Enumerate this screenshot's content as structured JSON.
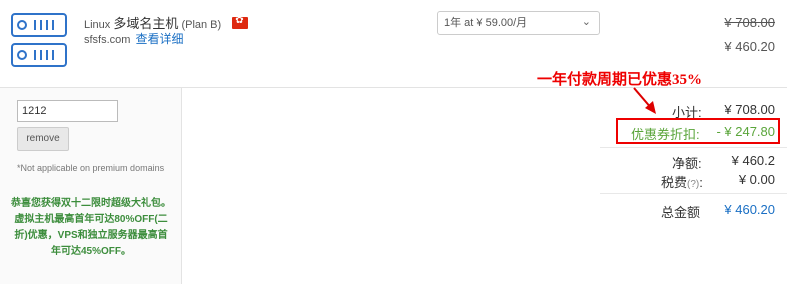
{
  "product": {
    "os": "Linux",
    "name": "多域名主机",
    "plan": "(Plan B)",
    "domain": "sfsfs.com",
    "details_link": "查看详细"
  },
  "billing": {
    "cycle_selected": "1年 at ¥ 59.00/月",
    "original_price": "¥ 708.00",
    "price": "¥ 460.20"
  },
  "promo": {
    "code_value": "1212",
    "remove_label": "remove",
    "not_applicable": "*Not applicable on premium domains",
    "message": "恭喜您获得双十二限时超级大礼包。虚拟主机最高首年可达80%OFF(二折)优惠，VPS和独立服务器最高首年可达45%OFF。"
  },
  "annotation": "一年付款周期已优惠35%",
  "summary": {
    "subtotal_label": "小计:",
    "subtotal_value": "¥ 708.00",
    "discount_label": "优惠券折扣:",
    "discount_value": "- ¥ 247.80",
    "net_label": "净额:",
    "net_value": "¥ 460.2",
    "tax_label": "税费",
    "tax_help": "(?)",
    "tax_colon": ":",
    "tax_value": "¥ 0.00",
    "total_label": "总金额",
    "total_value": "¥ 460.20"
  },
  "colors": {
    "accent_blue": "#1a6fc4",
    "discount_green": "#5aa53a",
    "annotation_red": "#ee0000",
    "promo_green": "#3c8d3c"
  }
}
